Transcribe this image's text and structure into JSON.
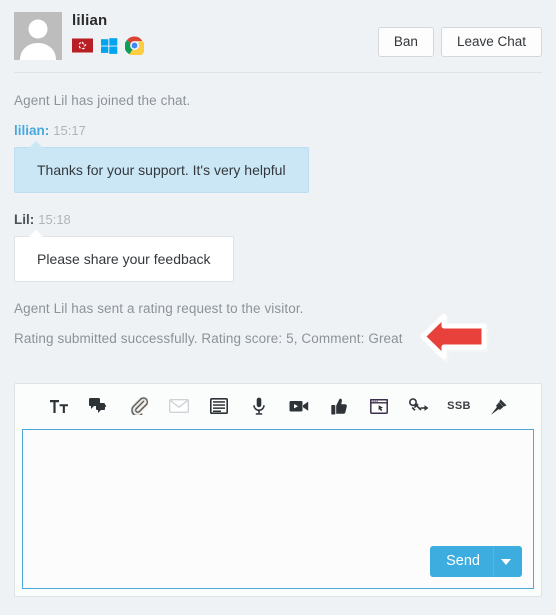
{
  "header": {
    "visitor_name": "lilian",
    "avatar_icon": "user-placeholder-avatar",
    "flag_icon": "hong-kong-flag-icon",
    "os_icon": "windows-logo-icon",
    "browser_icon": "google-chrome-icon",
    "ban_label": "Ban",
    "leave_chat_label": "Leave Chat"
  },
  "transcript": {
    "entries": [
      {
        "kind": "system",
        "text": "Agent Lil has joined the chat."
      },
      {
        "kind": "message",
        "role": "visitor",
        "author": "lilian:",
        "time": "15:17",
        "text": "Thanks for your support. It's very helpful"
      },
      {
        "kind": "message",
        "role": "agent",
        "author": "Lil:",
        "time": "15:18",
        "text": "Please share your feedback"
      },
      {
        "kind": "system",
        "text": "Agent Lil has sent a rating request to the visitor."
      },
      {
        "kind": "system",
        "text": "Rating submitted successfully. Rating score: 5, Comment: Great"
      }
    ]
  },
  "annotation": {
    "arrow_icon": "red-left-arrow-annotation",
    "color": "#e8403a"
  },
  "composer": {
    "tools": [
      {
        "name": "text-format-icon",
        "label": "Tт"
      },
      {
        "name": "canned-response-icon",
        "label": ""
      },
      {
        "name": "attachment-paperclip-icon",
        "label": ""
      },
      {
        "name": "email-transcript-icon",
        "label": ""
      },
      {
        "name": "notes-icon",
        "label": ""
      },
      {
        "name": "microphone-icon",
        "label": ""
      },
      {
        "name": "video-call-icon",
        "label": ""
      },
      {
        "name": "thumbs-up-icon",
        "label": ""
      },
      {
        "name": "screen-share-icon",
        "label": ""
      },
      {
        "name": "co-browse-icon",
        "label": ""
      },
      {
        "name": "ssb-icon",
        "label": "SSB"
      },
      {
        "name": "pin-icon",
        "label": ""
      }
    ],
    "editor_value": "",
    "editor_placeholder": "",
    "send_label": "Send",
    "send_caret_icon": "chevron-down-icon"
  },
  "colors": {
    "page_background": "#eff2f5",
    "accent_blue": "#3cadde",
    "visitor_bubble": "#cbe7f5",
    "agent_bubble": "#ffffff",
    "system_text": "#8b9399",
    "annotation_red": "#e8403a"
  }
}
